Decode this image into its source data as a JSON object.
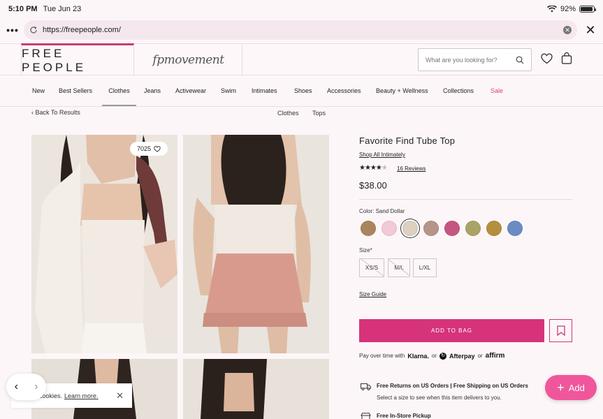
{
  "status_bar": {
    "time": "5:10 PM",
    "date": "Tue Jun 23",
    "battery": "92%",
    "battery_level": 0.92
  },
  "browser": {
    "url": "https://freepeople.com/"
  },
  "header": {
    "logo": "FREE PEOPLE",
    "logo_secondary": "fpmovement",
    "search_placeholder": "What are you looking for?"
  },
  "nav": {
    "items": [
      "New",
      "Best Sellers",
      "Clothes",
      "Jeans",
      "Activewear",
      "Swim",
      "Intimates",
      "Shoes",
      "Accessories",
      "Beauty + Wellness",
      "Collections",
      "Sale"
    ],
    "active": "Clothes"
  },
  "breadcrumb": {
    "back": "Back To Results",
    "crumbs": [
      "Clothes",
      "Tops"
    ]
  },
  "gallery": {
    "wishlist_count": "7025"
  },
  "product": {
    "title": "Favorite Find Tube Top",
    "shop_link": "Shop All Intimately",
    "rating": 4,
    "reviews": "16 Reviews",
    "price": "$38.00",
    "color_label": "Color: Sand Dollar",
    "swatches": [
      "#a8855e",
      "#f2c9d8",
      "#ddd0c0",
      "#b6948a",
      "#c75582",
      "#a9a466",
      "#b58f3e",
      "#6b8cc2"
    ],
    "selected_swatch": 2,
    "size_label": "Size*",
    "sizes": [
      "XS/S",
      "M/L",
      "L/XL"
    ],
    "size_guide": "Size Guide",
    "add_to_bag": "ADD TO BAG",
    "pay_prefix": "Pay over time with",
    "klarna": "Klarna.",
    "or1": "or",
    "afterpay": "Afterpay",
    "or2": "or",
    "affirm": "affirm",
    "returns_title": "Free Returns on US Orders | Free Shipping on US Orders",
    "returns_sub": "Select a size to see when this item delivers to you.",
    "pickup_title": "Free In-Store Pickup"
  },
  "cookie": {
    "text": "cookies.",
    "link": "Learn more."
  },
  "fab": {
    "label": "Add"
  }
}
